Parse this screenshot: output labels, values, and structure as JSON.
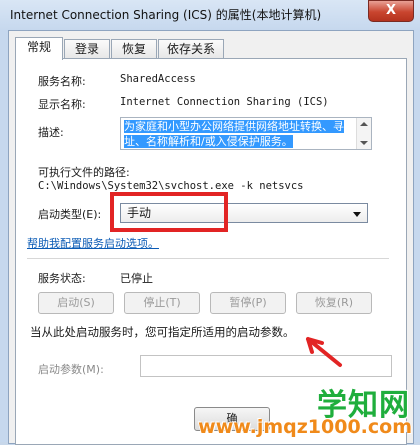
{
  "window": {
    "title": "Internet Connection Sharing (ICS) 的属性(本地计算机)",
    "close_label": "X"
  },
  "tabs": [
    {
      "label": "常规",
      "active": true
    },
    {
      "label": "登录"
    },
    {
      "label": "恢复"
    },
    {
      "label": "依存关系"
    }
  ],
  "general": {
    "service_name_label": "服务名称:",
    "service_name_value": "SharedAccess",
    "display_name_label": "显示名称:",
    "display_name_value": "Internet Connection Sharing (ICS)",
    "description_label": "描述:",
    "description_line1": "为家庭和小型办公网络提供网络地址转换、寻",
    "description_line2": "址、名称解析和/或入侵保护服务。",
    "exe_path_label": "可执行文件的路径:",
    "exe_path_value": "C:\\Windows\\System32\\svchost.exe -k netsvcs",
    "startup_type_label": "启动类型(E):",
    "startup_type_value": "手动",
    "help_link": "帮助我配置服务启动选项。",
    "status_label": "服务状态:",
    "status_value": "已停止",
    "start_button": "启动(S)",
    "stop_button": "停止(T)",
    "pause_button": "暂停(P)",
    "resume_button": "恢复(R)",
    "hint_text": "当从此处启动服务时，您可指定所适用的启动参数。",
    "start_params_label": "启动参数(M):",
    "start_params_value": "",
    "ok_button": "确"
  },
  "watermark": {
    "top": "学知网",
    "bottom": "www.jmqz1000.com"
  },
  "colors": {
    "highlight": "#e22424",
    "link": "#0b5bb5",
    "selection": "#3399ff"
  }
}
